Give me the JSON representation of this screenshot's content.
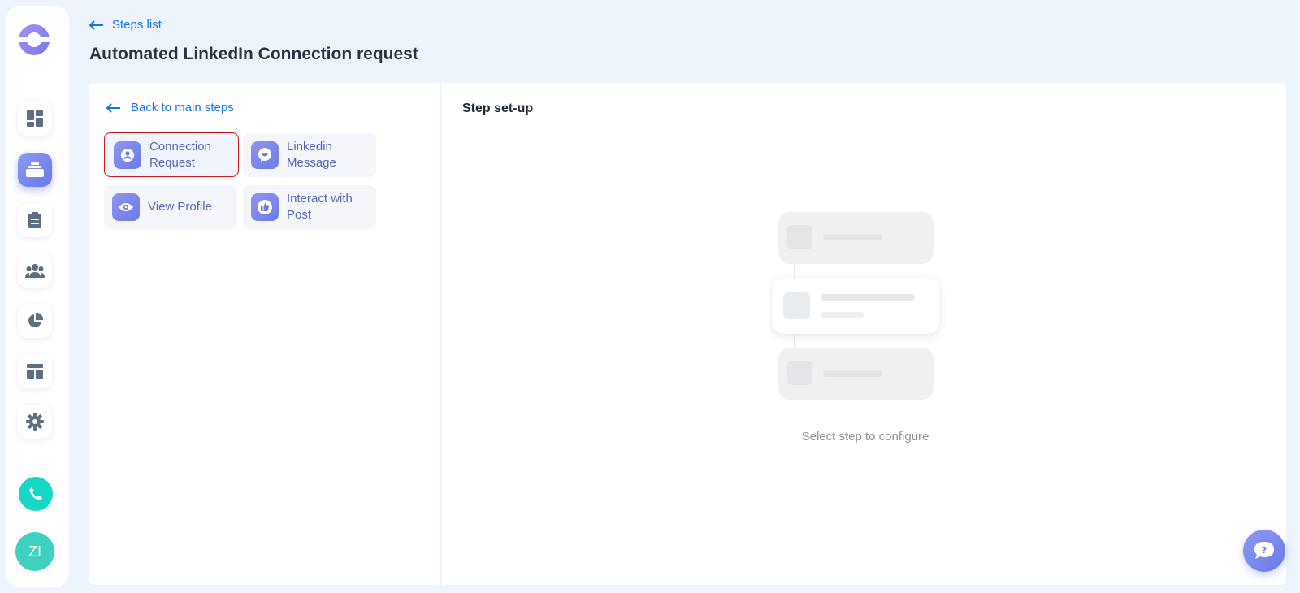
{
  "header": {
    "back_label": "Steps list",
    "title": "Automated LinkedIn Connection request"
  },
  "sidebar": {
    "items": [
      {
        "name": "dashboard",
        "icon": "dashboard-icon",
        "active": false
      },
      {
        "name": "campaigns",
        "icon": "campaigns-icon",
        "active": true
      },
      {
        "name": "tasks",
        "icon": "clipboard-icon",
        "active": false
      },
      {
        "name": "contacts",
        "icon": "people-icon",
        "active": false
      },
      {
        "name": "reports",
        "icon": "pie-chart-icon",
        "active": false
      },
      {
        "name": "templates",
        "icon": "layout-icon",
        "active": false
      },
      {
        "name": "settings",
        "icon": "gear-icon",
        "active": false
      }
    ],
    "avatar_initials": "ZI"
  },
  "left_panel": {
    "back_label": "Back to main steps",
    "steps": [
      {
        "label": "Connection Request",
        "icon": "person-icon",
        "selected": true
      },
      {
        "label": "Linkedin Message",
        "icon": "message-icon",
        "selected": false
      },
      {
        "label": "View Profile",
        "icon": "eye-icon",
        "selected": false
      },
      {
        "label": "Interact with Post",
        "icon": "thumbs-up-icon",
        "selected": false
      }
    ]
  },
  "right_panel": {
    "title": "Step set-up",
    "placeholder": "Select step to configure"
  },
  "colors": {
    "accent": "#1a73e8",
    "brand": "#6b77ea",
    "selected_border": "#d0161b",
    "teal": "#16d6c6"
  }
}
